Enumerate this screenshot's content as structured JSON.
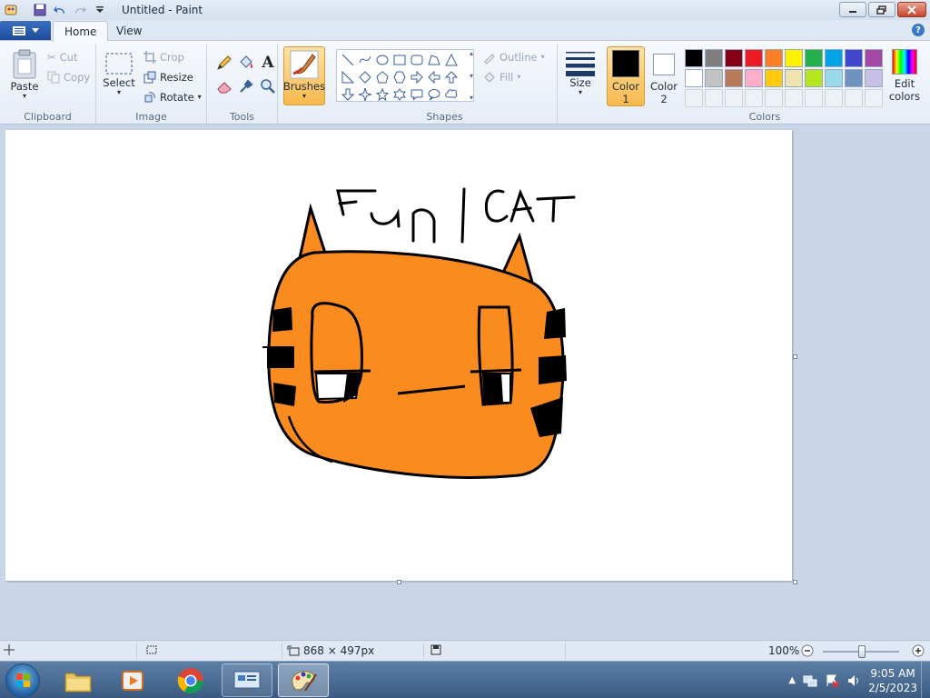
{
  "window": {
    "title": "Untitled - Paint"
  },
  "tabs": [
    {
      "label": "Home"
    },
    {
      "label": "View"
    }
  ],
  "clipboard": {
    "paste": "Paste",
    "cut": "Cut",
    "copy": "Copy",
    "group": "Clipboard"
  },
  "image": {
    "select": "Select",
    "crop": "Crop",
    "resize": "Resize",
    "rotate": "Rotate",
    "group": "Image"
  },
  "tools": {
    "group": "Tools"
  },
  "brushes": {
    "label": "Brushes"
  },
  "shapes": {
    "outline": "Outline",
    "fill": "Fill",
    "group": "Shapes"
  },
  "size": {
    "label": "Size"
  },
  "colors": {
    "color1_label": "Color",
    "color1_num": "1",
    "color2_label": "Color",
    "color2_num": "2",
    "edit_label": "Edit",
    "edit_label2": "colors",
    "group": "Colors",
    "color1": "#000000",
    "color2": "#ffffff",
    "row1": [
      "#000000",
      "#7f7f7f",
      "#880015",
      "#ed1c24",
      "#ff7f27",
      "#fff200",
      "#22b14c",
      "#00a2e8",
      "#3f48cc",
      "#a349a4"
    ],
    "row2": [
      "#ffffff",
      "#c3c3c3",
      "#b97a57",
      "#ffaec9",
      "#ffc90e",
      "#efe4b0",
      "#b5e61d",
      "#99d9ea",
      "#7092be",
      "#c8bfe7"
    ]
  },
  "drawing": {
    "text": "Funl CAT",
    "fill": "#f98b1f"
  },
  "status": {
    "dimensions": "868 × 497px",
    "zoom": "100%"
  },
  "taskbar": {
    "apps": [
      {
        "name": "Windows Explorer"
      },
      {
        "name": "Media Player"
      },
      {
        "name": "Google Chrome"
      },
      {
        "name": "Remote Desktop"
      },
      {
        "name": "Paint"
      }
    ],
    "time": "9:05 AM",
    "date": "2/5/2023"
  }
}
